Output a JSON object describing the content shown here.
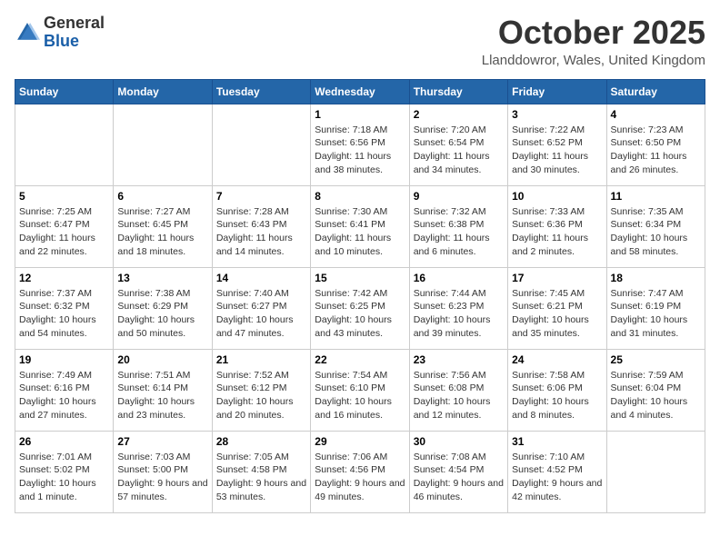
{
  "header": {
    "logo_general": "General",
    "logo_blue": "Blue",
    "month": "October 2025",
    "location": "Llanddowror, Wales, United Kingdom"
  },
  "days_of_week": [
    "Sunday",
    "Monday",
    "Tuesday",
    "Wednesday",
    "Thursday",
    "Friday",
    "Saturday"
  ],
  "weeks": [
    [
      {
        "day": "",
        "content": ""
      },
      {
        "day": "",
        "content": ""
      },
      {
        "day": "",
        "content": ""
      },
      {
        "day": "1",
        "content": "Sunrise: 7:18 AM\nSunset: 6:56 PM\nDaylight: 11 hours and 38 minutes."
      },
      {
        "day": "2",
        "content": "Sunrise: 7:20 AM\nSunset: 6:54 PM\nDaylight: 11 hours and 34 minutes."
      },
      {
        "day": "3",
        "content": "Sunrise: 7:22 AM\nSunset: 6:52 PM\nDaylight: 11 hours and 30 minutes."
      },
      {
        "day": "4",
        "content": "Sunrise: 7:23 AM\nSunset: 6:50 PM\nDaylight: 11 hours and 26 minutes."
      }
    ],
    [
      {
        "day": "5",
        "content": "Sunrise: 7:25 AM\nSunset: 6:47 PM\nDaylight: 11 hours and 22 minutes."
      },
      {
        "day": "6",
        "content": "Sunrise: 7:27 AM\nSunset: 6:45 PM\nDaylight: 11 hours and 18 minutes."
      },
      {
        "day": "7",
        "content": "Sunrise: 7:28 AM\nSunset: 6:43 PM\nDaylight: 11 hours and 14 minutes."
      },
      {
        "day": "8",
        "content": "Sunrise: 7:30 AM\nSunset: 6:41 PM\nDaylight: 11 hours and 10 minutes."
      },
      {
        "day": "9",
        "content": "Sunrise: 7:32 AM\nSunset: 6:38 PM\nDaylight: 11 hours and 6 minutes."
      },
      {
        "day": "10",
        "content": "Sunrise: 7:33 AM\nSunset: 6:36 PM\nDaylight: 11 hours and 2 minutes."
      },
      {
        "day": "11",
        "content": "Sunrise: 7:35 AM\nSunset: 6:34 PM\nDaylight: 10 hours and 58 minutes."
      }
    ],
    [
      {
        "day": "12",
        "content": "Sunrise: 7:37 AM\nSunset: 6:32 PM\nDaylight: 10 hours and 54 minutes."
      },
      {
        "day": "13",
        "content": "Sunrise: 7:38 AM\nSunset: 6:29 PM\nDaylight: 10 hours and 50 minutes."
      },
      {
        "day": "14",
        "content": "Sunrise: 7:40 AM\nSunset: 6:27 PM\nDaylight: 10 hours and 47 minutes."
      },
      {
        "day": "15",
        "content": "Sunrise: 7:42 AM\nSunset: 6:25 PM\nDaylight: 10 hours and 43 minutes."
      },
      {
        "day": "16",
        "content": "Sunrise: 7:44 AM\nSunset: 6:23 PM\nDaylight: 10 hours and 39 minutes."
      },
      {
        "day": "17",
        "content": "Sunrise: 7:45 AM\nSunset: 6:21 PM\nDaylight: 10 hours and 35 minutes."
      },
      {
        "day": "18",
        "content": "Sunrise: 7:47 AM\nSunset: 6:19 PM\nDaylight: 10 hours and 31 minutes."
      }
    ],
    [
      {
        "day": "19",
        "content": "Sunrise: 7:49 AM\nSunset: 6:16 PM\nDaylight: 10 hours and 27 minutes."
      },
      {
        "day": "20",
        "content": "Sunrise: 7:51 AM\nSunset: 6:14 PM\nDaylight: 10 hours and 23 minutes."
      },
      {
        "day": "21",
        "content": "Sunrise: 7:52 AM\nSunset: 6:12 PM\nDaylight: 10 hours and 20 minutes."
      },
      {
        "day": "22",
        "content": "Sunrise: 7:54 AM\nSunset: 6:10 PM\nDaylight: 10 hours and 16 minutes."
      },
      {
        "day": "23",
        "content": "Sunrise: 7:56 AM\nSunset: 6:08 PM\nDaylight: 10 hours and 12 minutes."
      },
      {
        "day": "24",
        "content": "Sunrise: 7:58 AM\nSunset: 6:06 PM\nDaylight: 10 hours and 8 minutes."
      },
      {
        "day": "25",
        "content": "Sunrise: 7:59 AM\nSunset: 6:04 PM\nDaylight: 10 hours and 4 minutes."
      }
    ],
    [
      {
        "day": "26",
        "content": "Sunrise: 7:01 AM\nSunset: 5:02 PM\nDaylight: 10 hours and 1 minute."
      },
      {
        "day": "27",
        "content": "Sunrise: 7:03 AM\nSunset: 5:00 PM\nDaylight: 9 hours and 57 minutes."
      },
      {
        "day": "28",
        "content": "Sunrise: 7:05 AM\nSunset: 4:58 PM\nDaylight: 9 hours and 53 minutes."
      },
      {
        "day": "29",
        "content": "Sunrise: 7:06 AM\nSunset: 4:56 PM\nDaylight: 9 hours and 49 minutes."
      },
      {
        "day": "30",
        "content": "Sunrise: 7:08 AM\nSunset: 4:54 PM\nDaylight: 9 hours and 46 minutes."
      },
      {
        "day": "31",
        "content": "Sunrise: 7:10 AM\nSunset: 4:52 PM\nDaylight: 9 hours and 42 minutes."
      },
      {
        "day": "",
        "content": ""
      }
    ]
  ]
}
